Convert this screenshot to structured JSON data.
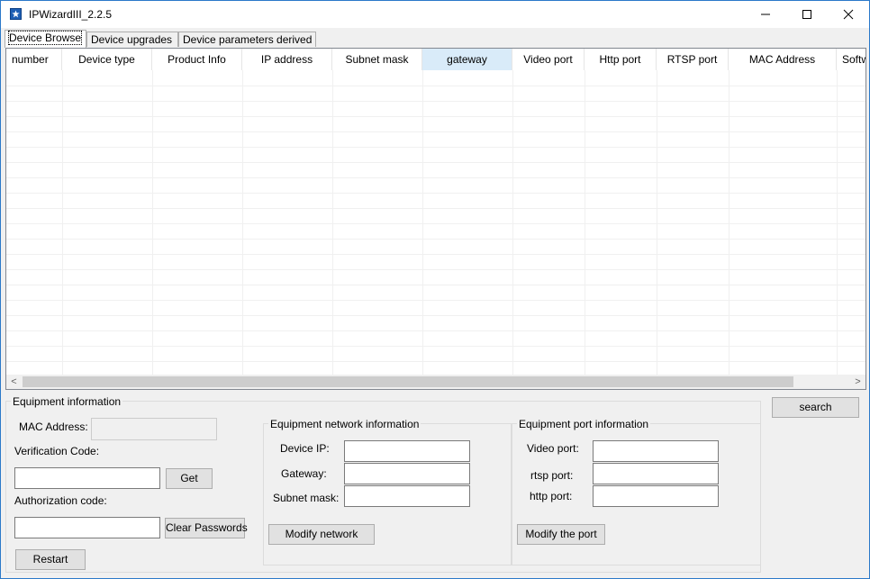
{
  "window": {
    "title": "IPWizardIII_2.2.5",
    "controls": {
      "minimize": "minimize-icon",
      "maximize": "maximize-icon",
      "close": "close-icon"
    }
  },
  "tabs": [
    "Device Browse",
    "Device upgrades",
    "Device parameters derived"
  ],
  "active_tab": "Device Browse",
  "table": {
    "columns": [
      "number",
      "Device type",
      "Product Info",
      "IP address",
      "Subnet mask",
      "gateway",
      "Video port",
      "Http port",
      "RTSP port",
      "MAC Address",
      "Softw"
    ],
    "selected_column": "gateway",
    "rows": []
  },
  "scrollbar": {
    "left_arrow": "<",
    "right_arrow": ">"
  },
  "equipment_info": {
    "title": "Equipment information",
    "mac_label": "MAC Address:",
    "mac_value": "",
    "verification_label": "Verification Code:",
    "verification_value": "",
    "get_button": "Get",
    "authorization_label": "Authorization code:",
    "authorization_value": "",
    "clear_button": "Clear Passwords",
    "restart_button": "Restart"
  },
  "network_info": {
    "title": "Equipment network information",
    "device_ip_label": "Device IP:",
    "gateway_label": "Gateway:",
    "subnet_label": "Subnet mask:",
    "device_ip_value": "",
    "gateway_value": "",
    "subnet_value": "",
    "modify_button": "Modify network"
  },
  "port_info": {
    "title": "Equipment port information",
    "video_label": "Video port:",
    "rtsp_label": "rtsp port:",
    "http_label": "http port:",
    "video_value": "",
    "rtsp_value": "",
    "http_value": "",
    "modify_button": "Modify the port"
  },
  "search_button": "search",
  "colors": {
    "window_border": "#2b79c9",
    "selected_header": "#d9ebf9",
    "background": "#f0f0f0"
  }
}
